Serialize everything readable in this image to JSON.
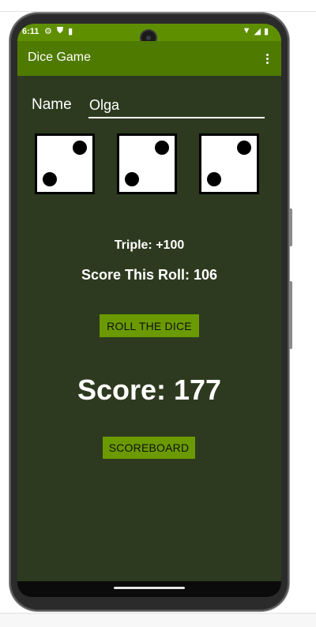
{
  "status_bar": {
    "time": "6:11",
    "left_icons": [
      "settings-icon",
      "shield-icon",
      "sd-card-icon"
    ],
    "right_icons": [
      "wifi-icon",
      "signal-icon",
      "battery-icon"
    ]
  },
  "app_bar": {
    "title": "Dice Game",
    "menu_icon": "more-vert-icon"
  },
  "player": {
    "name_label": "Name",
    "name_value": "Olga"
  },
  "dice": [
    {
      "value": 2
    },
    {
      "value": 2
    },
    {
      "value": 2
    }
  ],
  "bonus_text": "Triple: +100",
  "roll_score_text": "Score This Roll:  106",
  "roll_button_label": "ROLL THE DICE",
  "total_score_text": "Score: 177",
  "scoreboard_button_label": "SCOREBOARD",
  "colors": {
    "status_bar": "#5e8f00",
    "app_bar": "#4f7a00",
    "background": "#2d3a1f",
    "button": "#6a9a00"
  }
}
